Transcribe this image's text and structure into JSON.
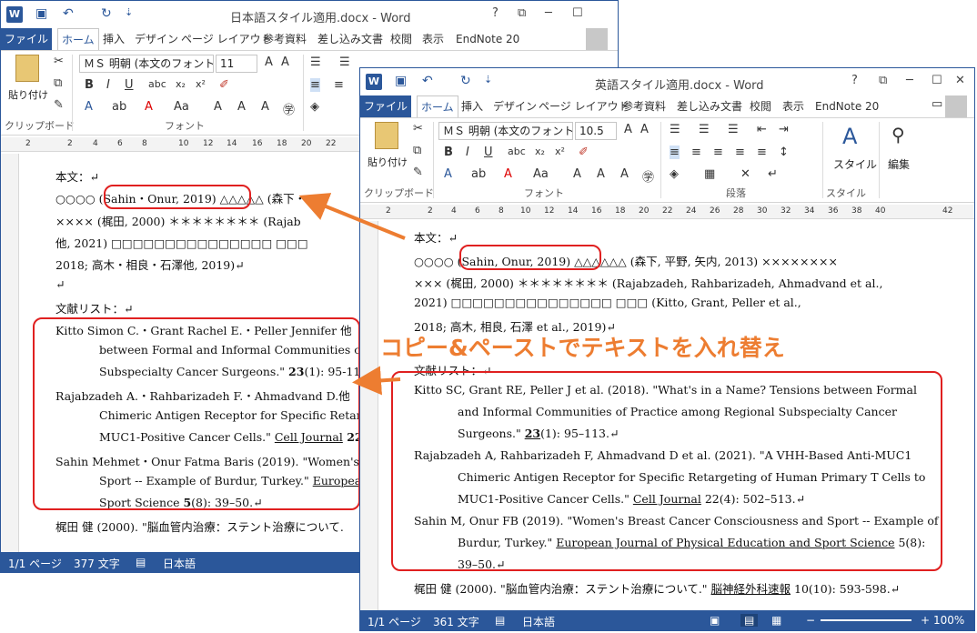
{
  "winA": {
    "title": "日本語スタイル適用.docx - Word",
    "tabs": [
      "ファイル",
      "ホーム",
      "挿入",
      "デザイン",
      "ページ レイアウト",
      "参考資料",
      "差し込み文書",
      "校閲",
      "表示",
      "EndNote 20"
    ],
    "font_name": "ＭＳ 明朝 (本文のフォント",
    "font_size": "11",
    "paste_label": "貼り付け",
    "group_clipboard": "クリップボード",
    "group_font": "フォント",
    "ruler_ticks": [
      "2",
      "2",
      "4",
      "6",
      "8",
      "10",
      "12",
      "14",
      "16",
      "18",
      "20",
      "22"
    ],
    "doc_lines": [
      "本文：↵",
      "○○○○ (Sahin・Onur, 2019) △△△△△ (森下・",
      "××××  (梶田, 2000)  ＊＊＊＊＊＊＊＊ (Rajab",
      "他, 2021) □□□□□□□□□□□□□□□  □□□",
      "2018; 高木・相良・石澤他, 2019)↵",
      "↵",
      "文献リスト：↵"
    ],
    "refs": [
      {
        "l1": "Kitto Simon C.・Grant Rachel E.・Peller Jennifer 他",
        "l2": "between Formal and Informal Communities of",
        "l3a": "Subspecialty Cancer Surgeons.\"  ",
        "l3b": "23",
        "l3c": "(1): 95-11"
      },
      {
        "l1": "Rajabzadeh A.・Rahbarizadeh F.・Ahmadvand D.他",
        "l2": "Chimeric Antigen Receptor for Specific Retarg",
        "l3a": "MUC1-Positive Cancer Cells.\" ",
        "l3b": "Cell Journal",
        "l3c": " 22"
      },
      {
        "l1": "Sahin Mehmet・Onur Fatma Baris (2019). \"Women's",
        "l2": "Sport -- Example of Burdur, Turkey.\" ",
        "l2u": "European",
        "l3a": "Sport Science ",
        "l3b": "5",
        "l3c": "(8): 39–50.↵"
      }
    ],
    "last_line": "梶田 健 (2000). \"脳血管内治療：ステント治療について.",
    "status": {
      "page": "1/1 ページ",
      "words": "377 文字",
      "lang": "日本語"
    }
  },
  "winB": {
    "title": "英語スタイル適用.docx - Word",
    "tabs": [
      "ファイル",
      "ホーム",
      "挿入",
      "デザイン",
      "ページ レイアウト",
      "参考資料",
      "差し込み文書",
      "校閲",
      "表示",
      "EndNote 20"
    ],
    "font_name": "ＭＳ 明朝 (本文のフォント",
    "font_size": "10.5",
    "paste_label": "貼り付け",
    "group_clipboard": "クリップボード",
    "group_font": "フォント",
    "group_paragraph": "段落",
    "group_style": "スタイル",
    "style_label": "スタイル",
    "edit_label": "編集",
    "ruler_ticks": [
      "2",
      "2",
      "4",
      "6",
      "8",
      "10",
      "12",
      "14",
      "16",
      "18",
      "20",
      "22",
      "24",
      "26",
      "28",
      "30",
      "32",
      "34",
      "36",
      "38",
      "40",
      "42"
    ],
    "doc_lines": [
      "本文：↵",
      "○○○○ (Sahin, Onur, 2019) △△△△△△ (森下, 平野, 矢内, 2013) ××××××××",
      "×××  (梶田, 2000)  ＊＊＊＊＊＊＊＊ (Rajabzadeh, Rahbarizadeh, Ahmadvand et al.,",
      "2021) □□□□□□□□□□□□□□□  □□□ (Kitto, Grant, Peller et al.,",
      "2018; 高木, 相良, 石澤 et al., 2019)↵",
      "文献リスト：↵"
    ],
    "refs": [
      {
        "l1": "Kitto SC, Grant RE, Peller J et al. (2018). \"What's in a Name? Tensions between Formal",
        "l2": "and Informal Communities of Practice among Regional Subspecialty Cancer",
        "l3a": "Surgeons.\"  ",
        "l3b": "23",
        "l3c": "(1): 95–113.↵"
      },
      {
        "l1": "Rajabzadeh A, Rahbarizadeh F, Ahmadvand D et al. (2021). \"A VHH-Based Anti-MUC1",
        "l2": "Chimeric Antigen Receptor for Specific Retargeting of Human Primary T Cells to",
        "l3a": "MUC1-Positive Cancer Cells.\" ",
        "l3b": "Cell Journal",
        "l3c": " 22(4): 502–513.↵"
      },
      {
        "l1": "Sahin M, Onur FB (2019). \"Women's Breast Cancer Consciousness and Sport -- Example of",
        "l2": "Burdur, Turkey.\" ",
        "l2u": "European Journal of Physical Education and Sport Science",
        "l2c": " 5(8):",
        "l3a": "39–50.↵"
      }
    ],
    "last_line_a": "梶田 健 (2000). \"脳血管内治療：ステント治療について.\" ",
    "last_line_u": "脳神経外科速報",
    "last_line_b": " 10(10): 593-598.↵",
    "status": {
      "page": "1/1 ページ",
      "words": "361 文字",
      "lang": "日本語",
      "zoom": "100%"
    }
  },
  "overlay_text": "コピー&ペーストでテキストを入れ替え",
  "colors": {
    "accent": "#2b579a",
    "annotation": "#e02020",
    "overlay": "#ed7d31"
  }
}
